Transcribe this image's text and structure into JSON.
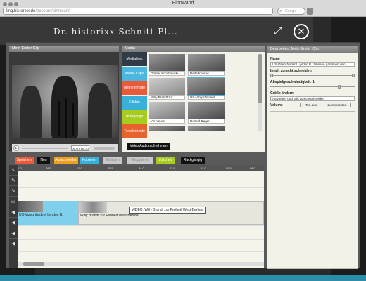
{
  "browser": {
    "title": "Pinnwand",
    "url_host": "ling.historixx.de",
    "url_path": "/account/pinnwand",
    "search_placeholder": "Google"
  },
  "site": {
    "logo": "Dr. historixx Schnitt-Pl..."
  },
  "player": {
    "title": "Mein Erster Clip",
    "time": "00.0 / 58.70"
  },
  "media": {
    "title": "Media",
    "menu": [
      {
        "label": "Mediathek",
        "color": "#2f3b45"
      },
      {
        "label": "Meine Clips",
        "color": "#4ab7e0"
      },
      {
        "label": "Meine Inhalte",
        "color": "#e85a3a"
      },
      {
        "label": "Effekte",
        "color": "#38b0d8"
      },
      {
        "label": "Übergänge",
        "color": "#a8cc1e"
      },
      {
        "label": "Textelemente",
        "color": "#e8622e"
      }
    ],
    "thumbs": [
      {
        "caption": "Günter Schabowski - "
      },
      {
        "caption": "Rede Konrad "
      },
      {
        "caption": "Willy Brandt zur "
      },
      {
        "caption": "US-Vizepräsident"
      },
      {
        "caption": "Ich bin ein "
      },
      {
        "caption": "Ronald Regen"
      }
    ],
    "record_button": "Video Audio aufnehmen"
  },
  "properties": {
    "title": "Bearbeiten: Mein Erster Clip",
    "name_label": "Name",
    "name_value": "US-Vizepräsident Lyndon B. Johnson garantiert den",
    "trim_label": "Inhalt zurecht schneiden",
    "speed_label": "Abspielgeschwindigkeit: 1",
    "size_label": "Größe ändern",
    "size_value": "Aufziehen und Bild zurechtschneiden",
    "volume_label": "Volume",
    "mute_button": "Ton aus",
    "reset_button": "Zurücksetzen"
  },
  "toolbar": {
    "buttons": [
      {
        "label": "Speichern",
        "color": "#e85a3a"
      },
      {
        "label": "Neu",
        "color": "#111111"
      },
      {
        "label": "Ausschneiden",
        "color": "#f0a020"
      },
      {
        "label": "Kopieren",
        "color": "#38b0d8"
      },
      {
        "label": "Einfügen",
        "color": "#c8c8c8"
      },
      {
        "label": "Gruppieren",
        "color": "#c8c8c8"
      },
      {
        "label": "Löschen",
        "color": "#a8cc1e"
      },
      {
        "label": "Rückgängig",
        "color": "#111111"
      }
    ]
  },
  "timeline": {
    "ticks": [
      "0.0",
      "08.5",
      "17.0",
      "25.5",
      "34.0",
      "42.5",
      "51.0",
      "59.5",
      "68.0",
      "76.5"
    ],
    "clip1_label": "US-Vizepräsident Lyndon B.",
    "clip2_label": "Willy Brandt zur Freiheit West-Berlins",
    "tooltip": "VIDEO: Willy Brandt zur Freiheit West-Berlins"
  }
}
